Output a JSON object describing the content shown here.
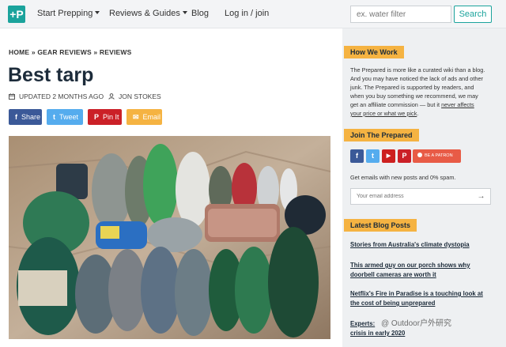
{
  "nav": {
    "logo_glyph": "+P",
    "items": [
      {
        "label": "Start Prepping",
        "has_caret": true
      },
      {
        "label": "Reviews & Guides",
        "has_caret": true
      },
      {
        "label": "Blog",
        "has_caret": false
      },
      {
        "label": "Log in / join",
        "has_caret": false
      }
    ],
    "search_placeholder": "ex. water filter",
    "search_button": "Search"
  },
  "article": {
    "breadcrumb": "HOME » GEAR REVIEWS » REVIEWS",
    "title": "Best tarp",
    "updated": "UPDATED 2 MONTHS AGO",
    "author": "JON STOKES",
    "share_buttons": [
      {
        "label": "Share",
        "glyph": "f",
        "color": "#3b5998"
      },
      {
        "label": "Tweet",
        "glyph": "t",
        "color": "#55acee"
      },
      {
        "label": "Pin It",
        "glyph": "P",
        "color": "#cb2027"
      },
      {
        "label": "Email",
        "glyph": "✉",
        "color": "#f5b342"
      }
    ],
    "photo_label": "Photo of assorted camping tarps in stuff sacks laid out on stone"
  },
  "sidebar": {
    "how_we_work": {
      "heading": "How We Work",
      "lines": [
        "The Prepared is more like a curated wiki than a blog.",
        "And you may have noticed the lack of ads and other",
        "junk. The Prepared is supported by readers, and",
        "when you buy something we recommend, we may",
        "get an affiliate commission — but it "
      ],
      "link1": "never affects",
      "link2": "your price or what we pick",
      "end": "."
    },
    "join": {
      "heading": "Join The Prepared",
      "social": [
        {
          "glyph": "f",
          "color": "#3b5998"
        },
        {
          "glyph": "t",
          "color": "#55acee"
        },
        {
          "glyph": "▶",
          "color": "#cd201f"
        },
        {
          "glyph": "P",
          "color": "#cb2027"
        }
      ],
      "patreon_label": "BE A PATRON",
      "email_text": "Get emails with new posts and 0% spam.",
      "email_placeholder": "Your email address",
      "email_button": "→"
    },
    "latest": {
      "heading": "Latest Blog Posts",
      "posts": [
        {
          "line1": "Stories from Australia's climate dystopia",
          "line2": ""
        },
        {
          "line1": "This armed guy on our porch shows why",
          "line2": "doorbell cameras are worth it"
        },
        {
          "line1": "Netflix's Fire in Paradise is a touching look at",
          "line2": "the cost of being unprepared"
        },
        {
          "line1": "Experts:",
          "line2": "crisis in early 2020"
        }
      ]
    }
  },
  "watermark": "@ Outdoor户外研究"
}
